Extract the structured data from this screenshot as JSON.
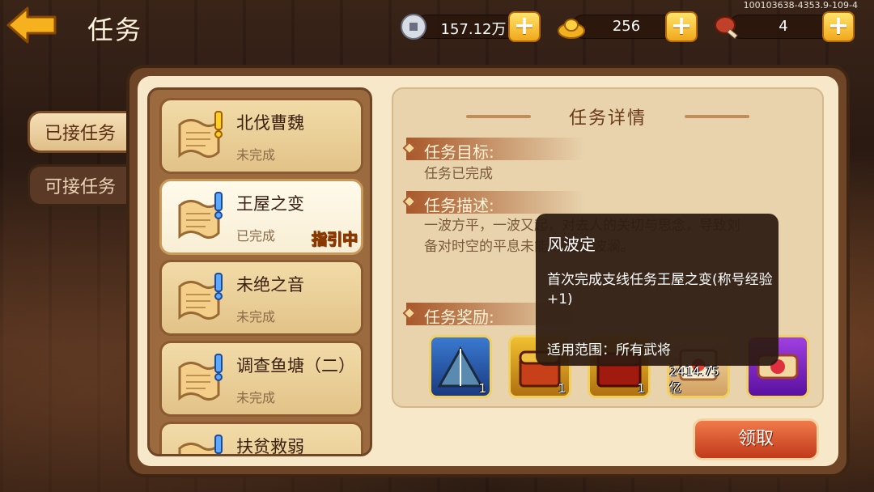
{
  "header": {
    "title": "任务",
    "version": "100103638-4353.9-109-4",
    "resources": [
      {
        "name": "silver",
        "value": "157.12万"
      },
      {
        "name": "gold",
        "value": "256"
      },
      {
        "name": "stamina",
        "value": "4"
      }
    ],
    "plus_label": "+"
  },
  "side_tabs": [
    {
      "label": "已接任务",
      "active": true
    },
    {
      "label": "可接任务",
      "active": false
    }
  ],
  "tasks": [
    {
      "name": "北伐曹魏",
      "status": "未完成"
    },
    {
      "name": "王屋之变",
      "status": "已完成",
      "guide": "指引中"
    },
    {
      "name": "未绝之音",
      "status": "未完成"
    },
    {
      "name": "调查鱼塘（二）",
      "status": "未完成"
    },
    {
      "name": "扶贫救弱",
      "status": ""
    }
  ],
  "detail": {
    "title": "任务详情",
    "goal_label": "任务目标:",
    "goal_text": "任务已完成",
    "desc_label": "任务描述:",
    "desc_line1": "一波方平，一波又起，对去人的关切与思念，导致刘",
    "desc_line2": "备对时空的平息未能... 再生波澜。",
    "reward_label": "任务奖励:",
    "rewards": [
      {
        "icon": "tent-icon",
        "count": "1"
      },
      {
        "icon": "treasure-chest-gold-icon",
        "count": "1"
      },
      {
        "icon": "treasure-chest-red-icon",
        "count": "1"
      },
      {
        "icon": "scroll-exp-icon",
        "count": "2414.75亿"
      },
      {
        "icon": "title-scroll-icon",
        "count": ""
      }
    ]
  },
  "claim_label": "领取",
  "tooltip": {
    "title": "风波定",
    "desc": "首次完成支线任务王屋之变(称号经验+1)",
    "scope": "适用范围：所有武将"
  },
  "colors": {
    "accent_gold": "#f0a81c",
    "claim_red": "#c23a1a",
    "guide_yellow": "#ffdf4a"
  }
}
